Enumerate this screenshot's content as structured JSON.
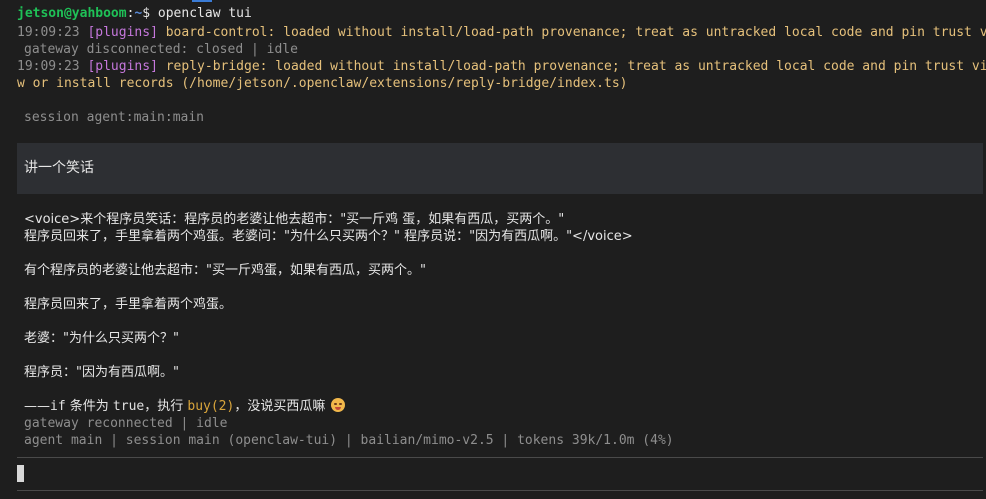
{
  "prompt": {
    "user": "jetson",
    "host": "yahboom",
    "path": "~",
    "symbol": "$",
    "command": "openclaw tui"
  },
  "logs": [
    {
      "time": "19:09:23",
      "tag": "[plugins]",
      "text": "board-control: loaded without install/load-path provenance; treat as untracked local code and pin trust via plugins.all"
    },
    {
      "status": "gateway disconnected: closed | idle"
    },
    {
      "time": "19:09:23",
      "tag": "[plugins]",
      "text": "reply-bridge: loaded without install/load-path provenance; treat as untracked local code and pin trust via plugins.allo",
      "cont": "w or install records (/home/jetson/.openclaw/extensions/reply-bridge/index.ts)"
    }
  ],
  "session_line": "session agent:main:main",
  "user_message": "讲一个笑话",
  "reply": {
    "line1": "<voice>来个程序员笑话：程序员的老婆让他去超市：\"买一斤鸡 蛋，如果有西瓜，买两个。\"",
    "line2": "程序员回来了，手里拿着两个鸡蛋。老婆问：\"为什么只买两个？\" 程序员说：\"因为有西瓜啊。\"</voice>",
    "line3": "有个程序员的老婆让他去超市：\"买一斤鸡蛋，如果有西瓜，买两个。\"",
    "line4": "程序员回来了，手里拿着两个鸡蛋。",
    "line5": "老婆：\"为什么只买两个？\"",
    "line6": "程序员：\"因为有西瓜啊。\"",
    "line7_prefix": "——",
    "line7_if": "if",
    "line7_mid": " 条件为 ",
    "line7_true": "true",
    "line7_mid2": "，执行 ",
    "line7_buy": "buy(2)",
    "line7_end": "，没说买西瓜嘛"
  },
  "status": {
    "gateway": "gateway reconnected | idle",
    "footer": "agent main | session main (openclaw-tui) | bailian/mimo-v2.5 | tokens 39k/1.0m (4%)"
  },
  "input": {
    "value": "",
    "placeholder": ""
  }
}
